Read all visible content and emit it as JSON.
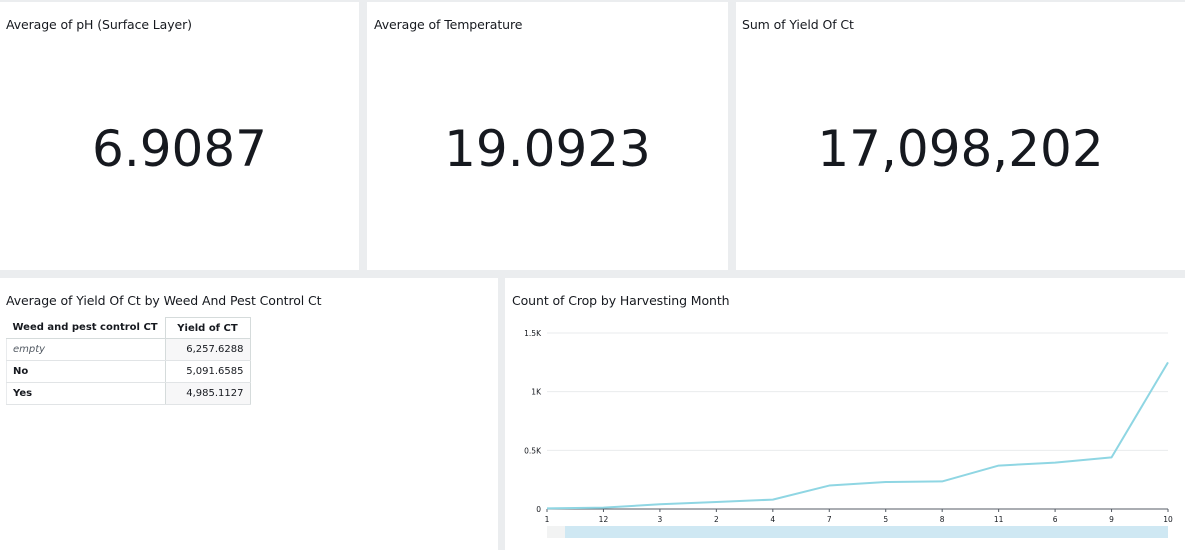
{
  "kpis": [
    {
      "title": "Average of pH (Surface Layer)",
      "value": "6.9087"
    },
    {
      "title": "Average of Temperature",
      "value": "19.0923"
    },
    {
      "title": "Sum of Yield Of Ct",
      "value": "17,098,202"
    }
  ],
  "pivot": {
    "title": "Average of Yield Of Ct by Weed And Pest Control Ct",
    "headers": {
      "key": "Weed and pest control CT",
      "value": "Yield of CT"
    },
    "rows": [
      {
        "key": "empty",
        "value": "6,257.6288"
      },
      {
        "key": "No",
        "value": "5,091.6585"
      },
      {
        "key": "Yes",
        "value": "4,985.1127"
      }
    ]
  },
  "line_chart": {
    "title": "Count of Crop by Harvesting Month",
    "colors": {
      "line": "#8fd6e3",
      "grid": "#e9ebed",
      "scrollbar": "#cfe8f3"
    }
  },
  "chart_data": {
    "type": "line",
    "title": "Count of Crop by Harvesting Month",
    "categories": [
      "1",
      "12",
      "3",
      "2",
      "4",
      "7",
      "5",
      "8",
      "11",
      "6",
      "9",
      "10"
    ],
    "values": [
      5,
      12,
      40,
      60,
      80,
      200,
      230,
      235,
      370,
      395,
      440,
      1250
    ],
    "y_ticks": [
      "0",
      "0.5K",
      "1K",
      "1.5K"
    ],
    "ylim": [
      0,
      1500
    ],
    "grid": true,
    "legend": "none"
  }
}
